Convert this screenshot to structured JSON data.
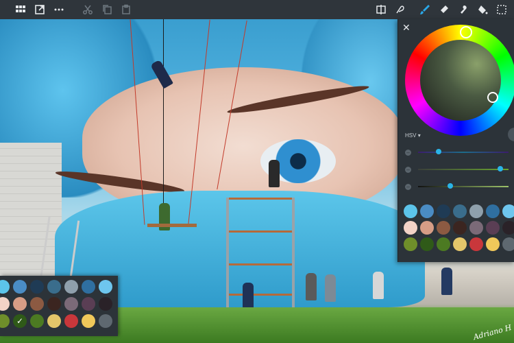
{
  "toolbar": {
    "left_icons": [
      "grid-icon",
      "export-icon",
      "more-icon",
      "cut-icon",
      "copy-icon",
      "paste-icon"
    ],
    "right_icons": [
      "mirror-icon",
      "lasso-icon",
      "brush-icon",
      "eraser-icon",
      "smudge-icon",
      "fill-icon",
      "select-icon"
    ],
    "active_tool": "brush-icon",
    "active_color": "#2aa8e8"
  },
  "color_panel": {
    "mode_label": "HSV",
    "swatch_colors": [
      "#5cc4ea",
      "#4a8cc4",
      "#1f3b55",
      "#3a6d8c",
      "#8fa0ac",
      "#2f6fa0",
      "#6ec6ee",
      "#f3d3c7",
      "#d79d86",
      "#8c5a42",
      "#3b2520",
      "#7b6a78",
      "#5a3e54",
      "#2a2228",
      "#6f8e2a",
      "#2f5a18",
      "#4c7a22",
      "#e4c66a",
      "#c9373b",
      "#f0c85a",
      "#5e6870"
    ]
  },
  "palette": {
    "swatch_colors": [
      "#5cc4ea",
      "#4a8cc4",
      "#1f3b55",
      "#3a6d8c",
      "#8fa0ac",
      "#2f6fa0",
      "#6ec6ee",
      "#f3d3c7",
      "#d79d86",
      "#8c5a42",
      "#3b2520",
      "#7b6a78",
      "#5a3e54",
      "#2a2228",
      "#6f8e2a",
      "#2f5a18",
      "#4c7a22",
      "#e4c66a",
      "#c9373b",
      "#f0c85a",
      "#5e6870"
    ],
    "selected_index": 15
  },
  "artwork": {
    "signature": "Adriano H"
  }
}
